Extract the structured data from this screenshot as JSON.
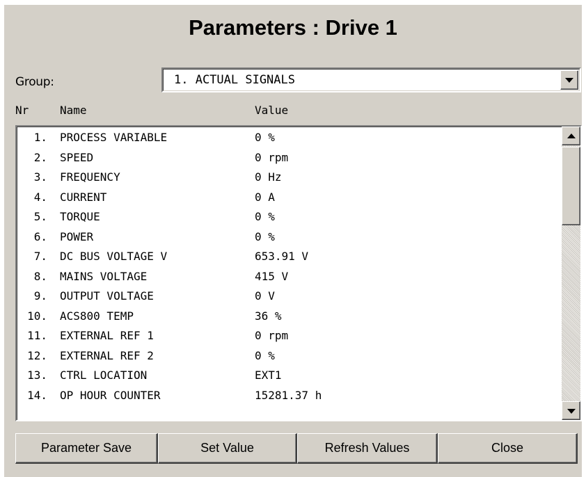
{
  "window": {
    "title": "Parameters : Drive 1"
  },
  "group": {
    "label": "Group:",
    "selected": "1. ACTUAL SIGNALS"
  },
  "columns": {
    "nr": "Nr",
    "name": "Name",
    "value": "Value"
  },
  "rows": [
    {
      "nr": "1.",
      "name": "PROCESS VARIABLE",
      "value": "0 %"
    },
    {
      "nr": "2.",
      "name": "SPEED",
      "value": "0 rpm"
    },
    {
      "nr": "3.",
      "name": "FREQUENCY",
      "value": "0 Hz"
    },
    {
      "nr": "4.",
      "name": "CURRENT",
      "value": "0 A"
    },
    {
      "nr": "5.",
      "name": "TORQUE",
      "value": "0 %"
    },
    {
      "nr": "6.",
      "name": "POWER",
      "value": "0 %"
    },
    {
      "nr": "7.",
      "name": "DC BUS VOLTAGE V",
      "value": "653.91 V"
    },
    {
      "nr": "8.",
      "name": "MAINS VOLTAGE",
      "value": "415 V"
    },
    {
      "nr": "9.",
      "name": "OUTPUT VOLTAGE",
      "value": "0 V"
    },
    {
      "nr": "10.",
      "name": "ACS800 TEMP",
      "value": "36 %"
    },
    {
      "nr": "11.",
      "name": "EXTERNAL REF 1",
      "value": "0 rpm"
    },
    {
      "nr": "12.",
      "name": "EXTERNAL REF 2",
      "value": "0 %"
    },
    {
      "nr": "13.",
      "name": "CTRL LOCATION",
      "value": "EXT1"
    },
    {
      "nr": "14.",
      "name": "OP HOUR COUNTER",
      "value": "15281.37 h"
    }
  ],
  "buttons": {
    "save": "Parameter Save",
    "set": "Set Value",
    "refresh": "Refresh Values",
    "close": "Close"
  },
  "icons": {
    "dropdown": "chevron-down-icon",
    "scroll_up": "arrow-up-icon",
    "scroll_down": "arrow-down-icon"
  }
}
